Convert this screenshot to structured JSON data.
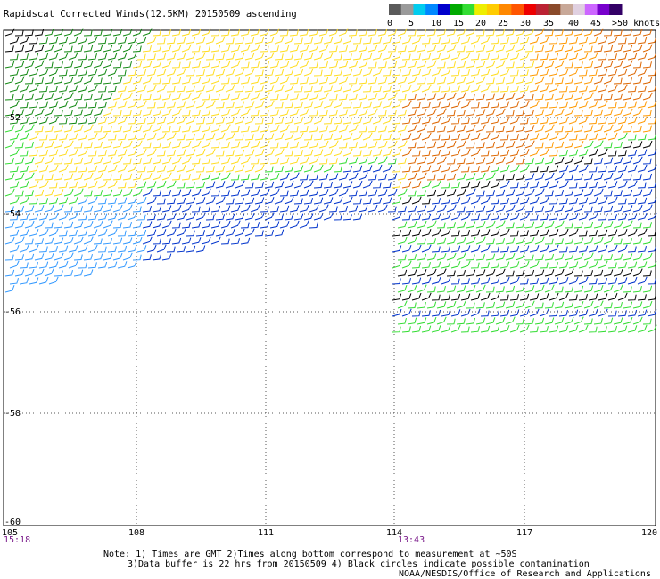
{
  "title": "Rapidscat Corrected Winds(12.5KM) 20150509 ascending",
  "legend": {
    "colors": [
      "#5a5a5a",
      "#9a9a9a",
      "#00ccee",
      "#0088ff",
      "#0000cc",
      "#00aa00",
      "#33dd33",
      "#eeee00",
      "#ffcc00",
      "#ff8800",
      "#ff5500",
      "#ee0000",
      "#bb2233",
      "#8a4a2a",
      "#c8a898",
      "#e0d0e0",
      "#cc66ff",
      "#7700cc",
      "#330066"
    ],
    "labels": [
      "0",
      "5",
      "10",
      "15",
      "20",
      "25",
      "30",
      "35",
      "40",
      "45",
      ">50 knots"
    ]
  },
  "axes": {
    "lon_labels": [
      "105",
      "108",
      "111",
      "114",
      "117",
      "120"
    ],
    "lat_labels": [
      "-52",
      "-54",
      "-56",
      "-58",
      "-60"
    ]
  },
  "times": {
    "left": "15:18",
    "middle": "13:43"
  },
  "notes": {
    "line1": "Note: 1) Times are GMT 2)Times along bottom correspond to measurement at ~50S",
    "line2": "3)Data buffer is 22 hrs from 20150509 4) Black circles indicate possible contamination",
    "credit": "NOAA/NESDIS/Office of Research and Applications"
  },
  "colors": {
    "black": "#000000",
    "dark_green": "#118811",
    "green": "#33dd33",
    "yellow": "#ffdd22",
    "orange": "#ff9900",
    "dark_orange": "#dd6600",
    "blue": "#0033cc",
    "light_blue": "#3399ff"
  }
}
